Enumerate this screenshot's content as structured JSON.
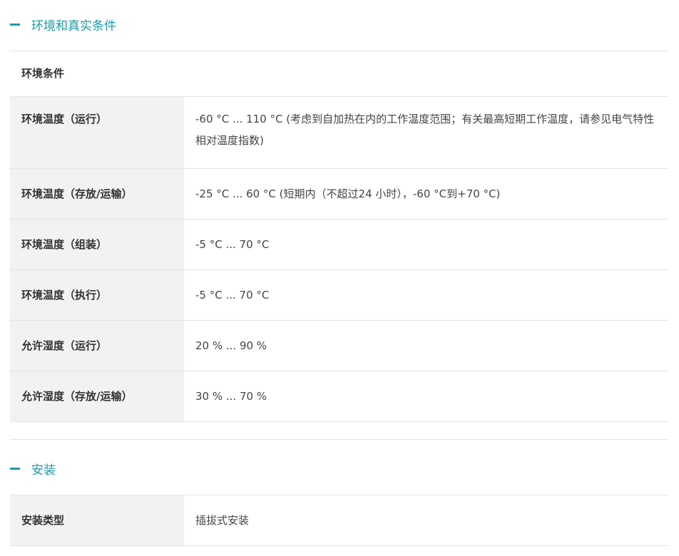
{
  "sections": {
    "environment": {
      "title": "环境和真实条件",
      "group_label": "环境条件",
      "rows": [
        {
          "label": "环境温度（运行）",
          "value": "-60 °C ... 110 °C (考虑到自加热在内的工作温度范围；有关最高短期工作温度，请参见电气特性相对温度指数)"
        },
        {
          "label": "环境温度（存放/运输）",
          "value": "-25 °C ... 60 °C (短期内（不超过24  小时），-60 °C到+70 °C)"
        },
        {
          "label": "环境温度（组装）",
          "value": "-5 °C ... 70 °C"
        },
        {
          "label": "环境温度（执行）",
          "value": "-5 °C ... 70 °C"
        },
        {
          "label": "允许湿度（运行）",
          "value": "20 % ... 90 %"
        },
        {
          "label": "允许湿度（存放/运输）",
          "value": "30 % ... 70 %"
        }
      ]
    },
    "installation": {
      "title": "安装",
      "rows": [
        {
          "label": "安装类型",
          "value": "插拔式安装"
        }
      ]
    }
  },
  "colors": {
    "accent": "#1e9aa5",
    "label_bg": "#f2f2f2",
    "divider": "#e4e4e4"
  },
  "icons": {
    "section_toggle": "minus-icon"
  }
}
